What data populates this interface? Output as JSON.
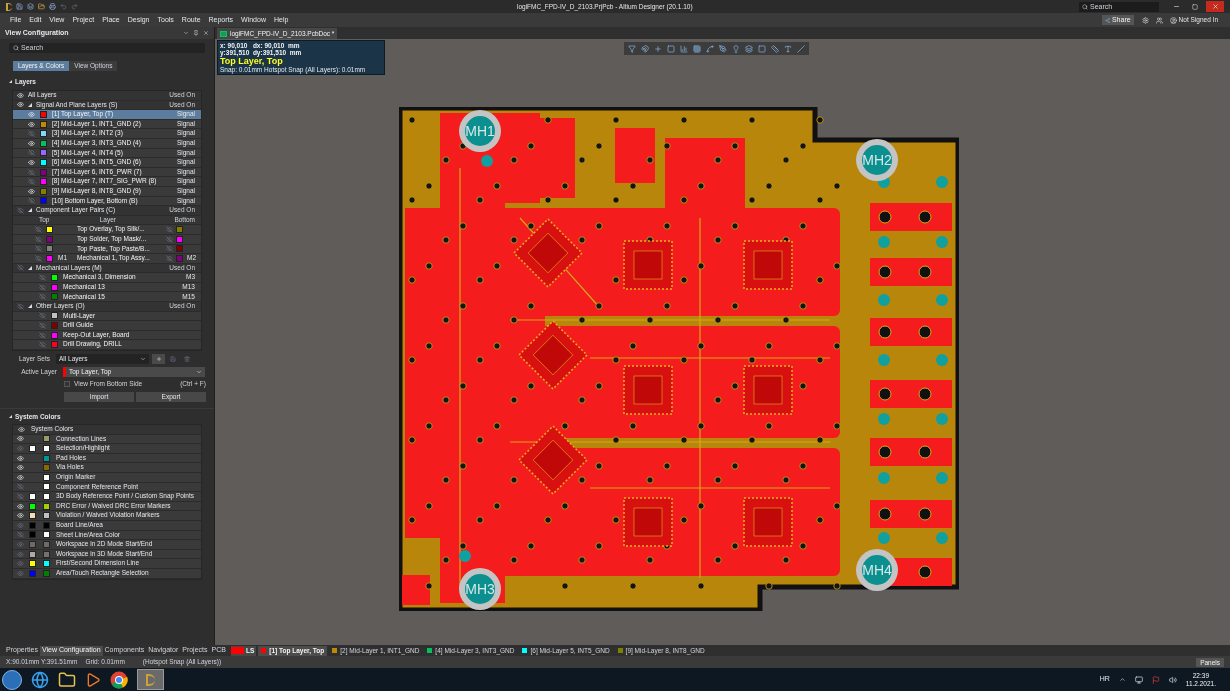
{
  "window": {
    "title": "logiFMC_FPD-IV_D_2103.PrjPcb - Altium Designer (20.1.10)",
    "search_placeholder": "Search",
    "share": "Share",
    "account": "Not Signed In"
  },
  "menu": [
    "File",
    "Edit",
    "View",
    "Project",
    "Place",
    "Design",
    "Tools",
    "Route",
    "Reports",
    "Window",
    "Help"
  ],
  "panel": {
    "title": "View Configuration",
    "search_placeholder": "Search",
    "tabs": [
      {
        "label": "Layers & Colors",
        "selected": true
      },
      {
        "label": "View Options",
        "selected": false
      }
    ],
    "layers_title": "Layers",
    "all": {
      "label": "All Layers",
      "used_on": "Used On",
      "visible": true
    },
    "groups": [
      {
        "kind": "signal",
        "label": "Signal And Plane Layers (S)",
        "used_on": "Used On",
        "visible": true,
        "expanded": true,
        "rows": [
          {
            "name": "[1] Top Layer, Top (T)",
            "color": "#ff0000",
            "visible": true,
            "used_on": "Signal",
            "selected": true
          },
          {
            "name": "[2] Mid-Layer 1, INT1_GND (2)",
            "color": "#c08a00",
            "visible": true,
            "used_on": "Signal",
            "selected": false
          },
          {
            "name": "[3] Mid-Layer 2, INT2 (3)",
            "color": "#80d8ff",
            "visible": false,
            "used_on": "Signal",
            "selected": false
          },
          {
            "name": "[4] Mid-Layer 3, INT3_GND (4)",
            "color": "#00c060",
            "visible": true,
            "used_on": "Signal",
            "selected": false
          },
          {
            "name": "[5] Mid-Layer 4, INT4 (5)",
            "color": "#9966ff",
            "visible": false,
            "used_on": "Signal",
            "selected": false
          },
          {
            "name": "[6] Mid-Layer 5, INT5_GND (6)",
            "color": "#00ffff",
            "visible": true,
            "used_on": "Signal",
            "selected": false
          },
          {
            "name": "[7] Mid-Layer 6, INT6_PWR (7)",
            "color": "#800080",
            "visible": false,
            "used_on": "Signal",
            "selected": false
          },
          {
            "name": "[8] Mid-Layer 7, INT7_SIG_PWR (8)",
            "color": "#ff00ff",
            "visible": false,
            "used_on": "Signal",
            "selected": false
          },
          {
            "name": "[9] Mid-Layer 8, INT8_GND (9)",
            "color": "#808000",
            "visible": true,
            "used_on": "Signal",
            "selected": false
          },
          {
            "name": "[10] Bottom Layer, Bottom (B)",
            "color": "#0000ff",
            "visible": false,
            "used_on": "Signal",
            "selected": false
          }
        ]
      },
      {
        "kind": "pairs",
        "label": "Component Layer Pairs (C)",
        "used_on": "Used On",
        "visible": false,
        "expanded": true,
        "columns": [
          "Top",
          "Layer",
          "Bottom"
        ],
        "rows": [
          {
            "top": {
              "color": "#ffff00",
              "visible": false
            },
            "layer": "Top Overlay, Top Silk/...",
            "bottom": {
              "color": "#808000",
              "visible": false
            }
          },
          {
            "top": {
              "color": "#800080",
              "visible": false
            },
            "layer": "Top Solder, Top Mask/...",
            "bottom": {
              "color": "#ff00ff",
              "visible": false
            }
          },
          {
            "top": {
              "color": "#808080",
              "visible": false
            },
            "layer": "Top Paste, Top Paste/B...",
            "bottom": {
              "color": "#800000",
              "visible": false
            }
          },
          {
            "top": {
              "color": "#ff00ff",
              "visible": false,
              "tag": "M1"
            },
            "layer": "Mechanical 1, Top Assy...",
            "bottom": {
              "color": "#800080",
              "visible": false,
              "tag": "M2"
            }
          }
        ]
      },
      {
        "kind": "simple",
        "label": "Mechanical Layers (M)",
        "used_on": "Used On",
        "visible": false,
        "expanded": true,
        "rows": [
          {
            "name": "Mechanical 3, Dimension",
            "color": "#00ff00",
            "visible": false,
            "used_on": "M3"
          },
          {
            "name": "Mechanical 13",
            "color": "#ff00ff",
            "visible": false,
            "used_on": "M13"
          },
          {
            "name": "Mechanical 15",
            "color": "#008000",
            "visible": false,
            "used_on": "M15"
          }
        ]
      },
      {
        "kind": "simple",
        "label": "Other Layers (O)",
        "used_on": "Used On",
        "visible": false,
        "expanded": true,
        "rows": [
          {
            "name": "Multi-Layer",
            "color": "#c0c0c0",
            "visible": false
          },
          {
            "name": "Drill Guide",
            "color": "#800000",
            "visible": false
          },
          {
            "name": "Keep-Out Layer, Board",
            "color": "#ff00ff",
            "visible": false
          },
          {
            "name": "Drill Drawing, DRILL",
            "color": "#ff0020",
            "visible": false
          }
        ]
      }
    ],
    "layer_sets": {
      "label": "Layer Sets",
      "value": "All Layers"
    },
    "active_layer": {
      "label": "Active Layer",
      "value": "Top Layer, Top",
      "color": "#ff0000"
    },
    "view_from_bottom": {
      "label": "View From Bottom Side",
      "shortcut": "(Ctrl + F)",
      "checked": false
    },
    "buttons": [
      "Import",
      "Export"
    ],
    "system_title": "System Colors",
    "system_header": "System Colors",
    "system_rows": [
      {
        "label": "Connection Lines",
        "visible": true,
        "active": true,
        "secondary": {
          "color": "#9c9b6b"
        }
      },
      {
        "label": "Selection/Highlight",
        "visible": true,
        "active": false,
        "primary": {
          "color": "#ffffff"
        },
        "secondary": {
          "color": "#ffffff"
        }
      },
      {
        "label": "Pad Holes",
        "visible": true,
        "active": true,
        "secondary": {
          "color": "#009999"
        }
      },
      {
        "label": "Via Holes",
        "visible": true,
        "active": true,
        "secondary": {
          "color": "#8a6a00"
        }
      },
      {
        "label": "Origin Marker",
        "visible": true,
        "active": true,
        "secondary": {
          "color": "#ffffff"
        }
      },
      {
        "label": "Component Reference Point",
        "visible": false,
        "active": false,
        "secondary": {
          "color": "#ffffff"
        }
      },
      {
        "label": "3D Body Reference Point / Custom Snap Points",
        "visible": false,
        "active": false,
        "primary": {
          "color": "#ffffff"
        },
        "secondary": {
          "color": "#ffffff"
        }
      },
      {
        "label": "DRC Error / Waived DRC Error Markers",
        "visible": true,
        "active": true,
        "primary": {
          "color": "#00ff00"
        },
        "secondary": {
          "color": "#a0d000"
        }
      },
      {
        "label": "Violation / Waived Violation Markers",
        "visible": true,
        "active": true,
        "primary": {
          "color": "#f5deb3"
        },
        "secondary": {
          "color": "#c0c0c0"
        }
      },
      {
        "label": "Board Line/Area",
        "visible": true,
        "active": false,
        "primary": {
          "color": "#000000"
        },
        "secondary": {
          "color": "#000000"
        }
      },
      {
        "label": "Sheet Line/Area Color",
        "visible": false,
        "active": false,
        "primary": {
          "color": "#000000"
        },
        "secondary": {
          "color": "#ffffff"
        }
      },
      {
        "label": "Workspace in 2D Mode Start/End",
        "visible": true,
        "active": false,
        "primary": {
          "color": "#6e6a66"
        },
        "secondary": {
          "color": "#6e6a66"
        }
      },
      {
        "label": "Workspace in 3D Mode Start/End",
        "visible": true,
        "active": false,
        "primary": {
          "color": "#b0a8a8"
        },
        "secondary": {
          "color": "#7a6e6e"
        }
      },
      {
        "label": "First/Second Dimension Line",
        "visible": true,
        "active": false,
        "primary": {
          "color": "#ffff00"
        },
        "secondary": {
          "color": "#00ffff"
        }
      },
      {
        "label": "Area/Touch Rectangle Selection",
        "visible": true,
        "active": false,
        "primary": {
          "color": "#0000ff"
        },
        "secondary": {
          "color": "#008000"
        }
      }
    ]
  },
  "document_tab": "logiFMC_FPD-IV_D_2103.PcbDoc *",
  "coordinates": {
    "lines": [
      "x: 90,010   dx: 90,010  mm",
      "y:391,510  dy:391,510  mm"
    ],
    "layer": "Top Layer, Top",
    "snap": "Snap: 0.01mm Hotspot Snap (All Layers): 0.01mm"
  },
  "mounting_holes": [
    "MH1",
    "MH2",
    "MH3",
    "MH4"
  ],
  "panel_tabs": [
    {
      "label": "Properties",
      "selected": false
    },
    {
      "label": "View Configuration",
      "selected": true
    },
    {
      "label": "Components",
      "selected": false
    },
    {
      "label": "Navigator",
      "selected": false
    },
    {
      "label": "Projects",
      "selected": false
    },
    {
      "label": "PCB",
      "selected": false
    }
  ],
  "layer_set_tab": {
    "label": "LS",
    "color": "#ff0000"
  },
  "layer_tabs": [
    {
      "label": "[1] Top Layer, Top",
      "color": "#ff0000",
      "selected": true
    },
    {
      "label": "[2] Mid-Layer 1, INT1_GND",
      "color": "#c08a00",
      "selected": false
    },
    {
      "label": "[4] Mid-Layer 3, INT3_GND",
      "color": "#00c060",
      "selected": false
    },
    {
      "label": "[6] Mid-Layer 5, INT5_GND",
      "color": "#00ffff",
      "selected": false
    },
    {
      "label": "[9] Mid-Layer 8, INT8_GND",
      "color": "#808000",
      "selected": false
    }
  ],
  "status": [
    "X:90.01mm Y:391.51mm",
    "Grid: 0.01mm",
    "(Hotspot Snap (All Layers))"
  ],
  "panels_button": "Panels",
  "taskbar": {
    "language": "HR",
    "time": "22:39",
    "date": "11.2.2021."
  }
}
